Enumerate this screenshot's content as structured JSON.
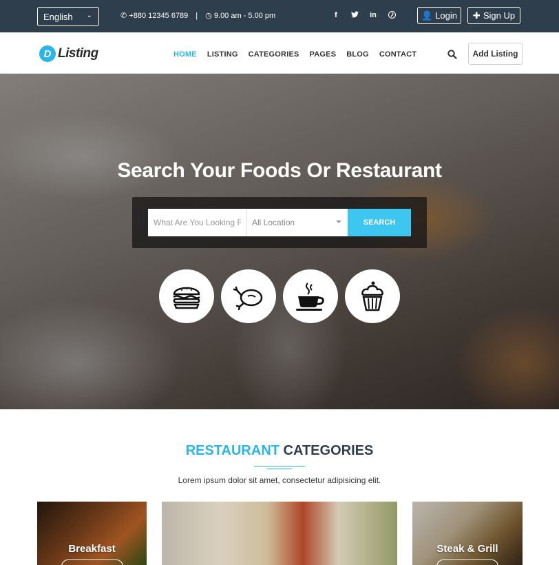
{
  "topbar": {
    "language": "English",
    "phone": "+880 12345 6789",
    "separator": "|",
    "hours": "9.00 am - 5.00 pm",
    "social": [
      "f",
      "t",
      "in",
      "p"
    ],
    "login_label": "Login",
    "signup_label": "Sign Up"
  },
  "nav": {
    "logo_mark": "D",
    "logo_text": "Listing",
    "items": [
      "HOME",
      "LISTING",
      "CATEGORIES",
      "PAGES",
      "BLOG",
      "CONTACT"
    ],
    "active": "HOME",
    "add_listing_label": "Add Listing"
  },
  "hero": {
    "title": "Search Your Foods Or Restaurant",
    "search_placeholder": "What Are You Looking For?",
    "location_value": "All Location",
    "search_button": "SEARCH",
    "food_icons": [
      "burger-icon",
      "chicken-icon",
      "coffee-cup-icon",
      "cupcake-icon"
    ]
  },
  "categories": {
    "title_highlight": "RESTAURANT",
    "title_rest": "CATEGORIES",
    "subtitle": "Lorem ipsum dolor sit amet, consectetur adipisicing elit.",
    "cards": [
      {
        "label": "Breakfast"
      },
      {
        "label": ""
      },
      {
        "label": "Steak & Grill"
      }
    ]
  },
  "colors": {
    "accent": "#29b6e8",
    "topbar_bg": "#2f3e4d",
    "search_button_bg": "#3dc6f0"
  }
}
